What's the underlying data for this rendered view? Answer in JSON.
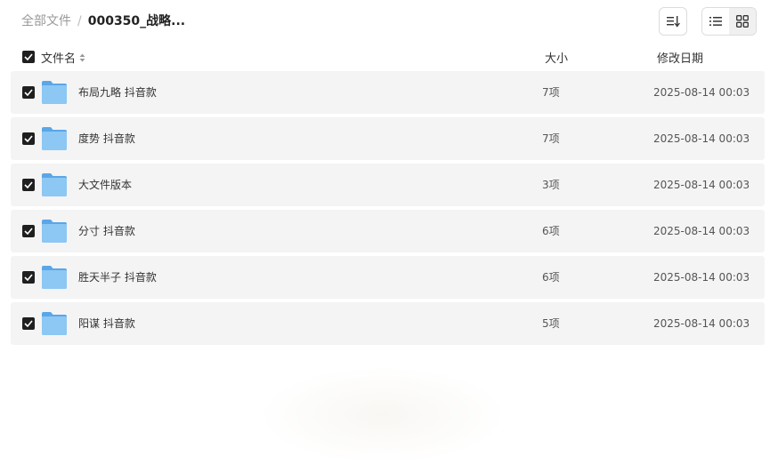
{
  "breadcrumb": {
    "root": "全部文件",
    "separator": "/",
    "current": "000350_战略..."
  },
  "toolbar": {
    "sort_icon": "sort-icon",
    "list_view_icon": "list-view-icon",
    "grid_view_icon": "grid-view-icon"
  },
  "table": {
    "headers": {
      "name": "文件名",
      "size": "大小",
      "date": "修改日期"
    },
    "rows": [
      {
        "name": "布局九略 抖音款",
        "size": "7项",
        "date": "2025-08-14 00:03"
      },
      {
        "name": "度势 抖音款",
        "size": "7项",
        "date": "2025-08-14 00:03"
      },
      {
        "name": "大文件版本",
        "size": "3项",
        "date": "2025-08-14 00:03"
      },
      {
        "name": "分寸 抖音款",
        "size": "6项",
        "date": "2025-08-14 00:03"
      },
      {
        "name": "胜天半子 抖音款",
        "size": "6项",
        "date": "2025-08-14 00:03"
      },
      {
        "name": "阳谋 抖音款",
        "size": "5项",
        "date": "2025-08-14 00:03"
      }
    ]
  },
  "colors": {
    "row_bg": "#f4f4f4",
    "folder_blue": "#7cbcef",
    "checkbox": "#1f1f1f"
  }
}
